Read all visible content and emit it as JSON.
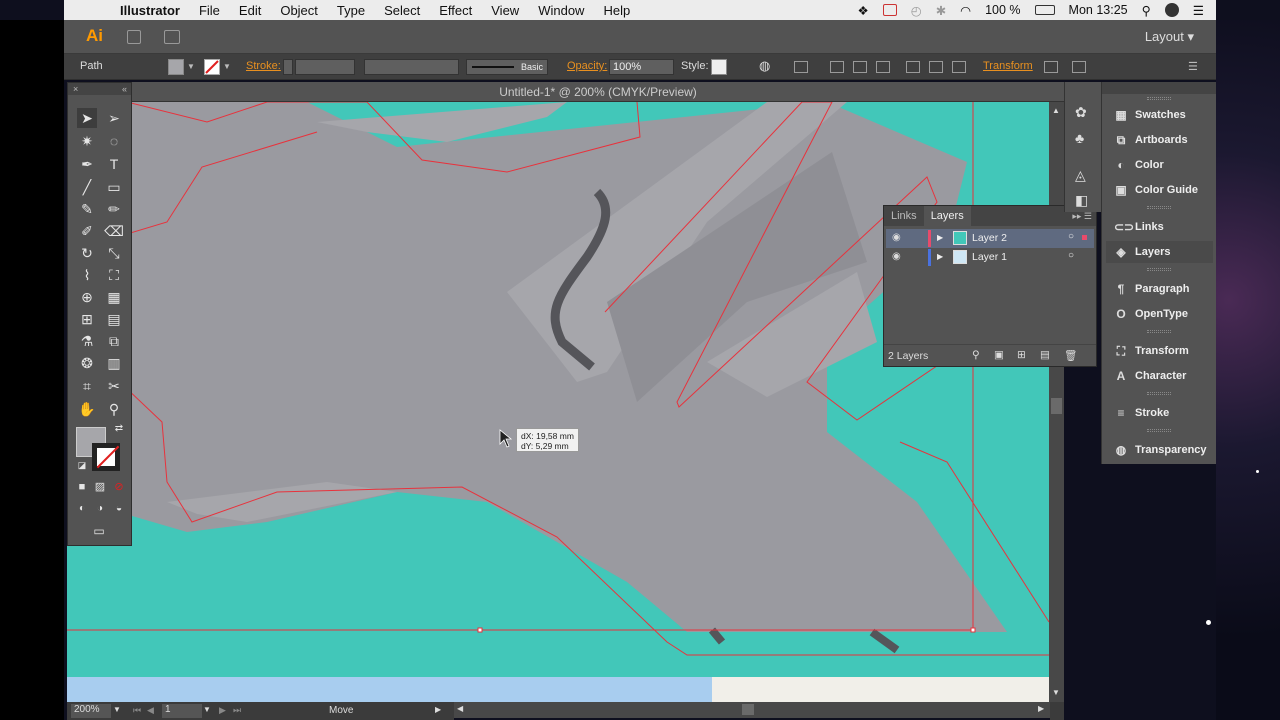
{
  "menubar": {
    "app_name": "Illustrator",
    "items": [
      "File",
      "Edit",
      "Object",
      "Type",
      "Select",
      "Effect",
      "View",
      "Window",
      "Help"
    ],
    "battery": "100 %",
    "clock": "Mon 13:25"
  },
  "appbar": {
    "logo": "Ai",
    "layout_label": "Layout"
  },
  "control": {
    "selection_type": "Path",
    "stroke_label": "Stroke:",
    "brush_label": "Basic",
    "opacity_label": "Opacity:",
    "opacity_value": "100%",
    "style_label": "Style:",
    "transform_label": "Transform"
  },
  "document": {
    "tab_title": "Untitled-1* @ 200% (CMYK/Preview)"
  },
  "tooltip": {
    "dx": "dX: 19,58 mm",
    "dy": "dY: 5,29 mm"
  },
  "status": {
    "zoom": "200%",
    "artboard": "1",
    "tool": "Move"
  },
  "layers_panel": {
    "tabs": [
      "Links",
      "Layers"
    ],
    "active_tab": "Layers",
    "layers": [
      {
        "name": "Layer 2",
        "color": "#e84b6b",
        "selected": true
      },
      {
        "name": "Layer 1",
        "color": "#4a72e0",
        "selected": false
      }
    ],
    "footer": "2 Layers"
  },
  "dock": {
    "items": [
      {
        "label": "Swatches",
        "icon": "swatches-icon"
      },
      {
        "label": "Artboards",
        "icon": "artboards-icon"
      },
      {
        "label": "Color",
        "icon": "color-icon"
      },
      {
        "label": "Color Guide",
        "icon": "color-guide-icon"
      },
      {
        "label": "Links",
        "icon": "links-icon"
      },
      {
        "label": "Layers",
        "icon": "layers-icon"
      },
      {
        "label": "Paragraph",
        "icon": "paragraph-icon"
      },
      {
        "label": "OpenType",
        "icon": "opentype-icon"
      },
      {
        "label": "Transform",
        "icon": "transform-icon"
      },
      {
        "label": "Character",
        "icon": "character-icon"
      },
      {
        "label": "Stroke",
        "icon": "stroke-icon"
      },
      {
        "label": "Transparency",
        "icon": "transparency-icon"
      }
    ]
  },
  "colors": {
    "water": "#42c7b9",
    "land": "#9a9aa0",
    "land_light": "#a6a6ab",
    "road": "#55555a",
    "guide": "#e8323c",
    "accent": "#e89020"
  }
}
